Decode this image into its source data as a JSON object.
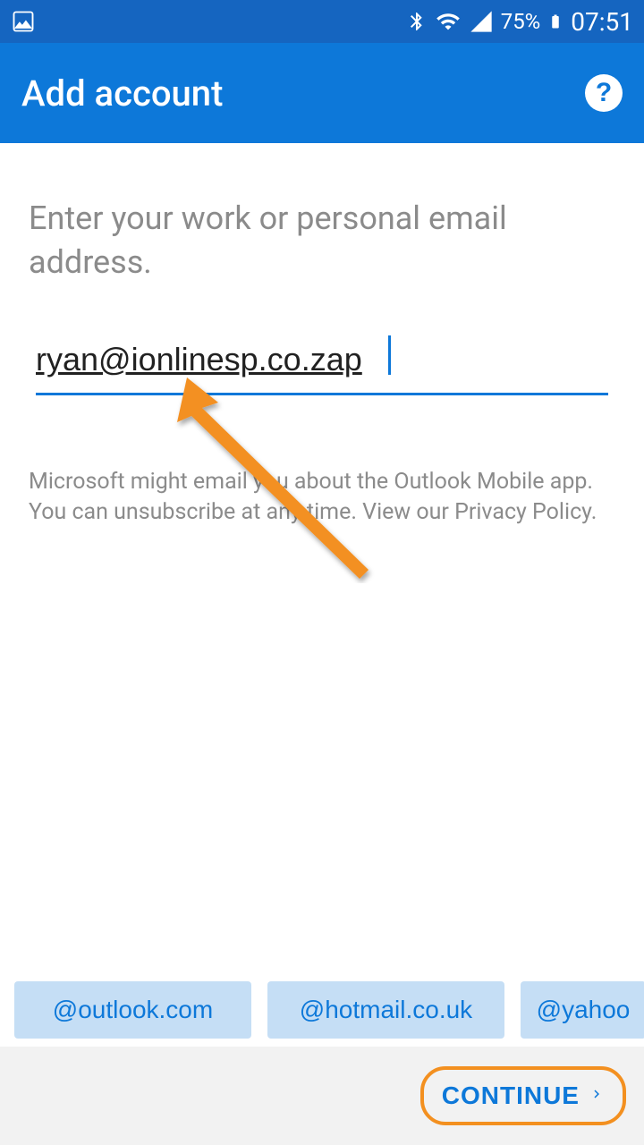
{
  "status_bar": {
    "battery_percent": "75%",
    "time": "07:51"
  },
  "app_bar": {
    "title": "Add account",
    "help_label": "?"
  },
  "content": {
    "instruction": "Enter your work or personal email address.",
    "email_value": "ryan@ionlinesp.co.zap",
    "privacy": "Microsoft might email you about the Outlook Mobile app. You can unsubscribe at any time. View our Privacy Policy."
  },
  "suggestions": {
    "chip1": "@outlook.com",
    "chip2": "@hotmail.co.uk",
    "chip3": "@yahoo"
  },
  "footer": {
    "continue_label": "CONTINUE"
  },
  "annotation": {
    "arrow_color": "#f39020",
    "highlight_color": "#f39020"
  }
}
